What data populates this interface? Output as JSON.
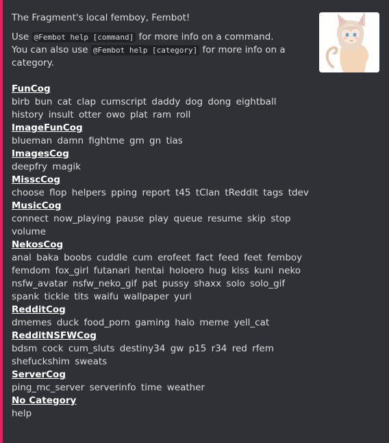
{
  "embed": {
    "accent_color": "#e91e63",
    "intro": "The Fragment's local femboy, Fembot!",
    "usage_line1_prefix": "Use",
    "usage_line1_code": "@Fembot help [command]",
    "usage_line1_suffix": "for more info on a command.",
    "usage_line2_prefix": "You can also use",
    "usage_line2_code": "@Fembot help [category]",
    "usage_line2_suffix": "for more info on a category."
  },
  "categories": [
    {
      "name": "FunCog",
      "commands": [
        "birb",
        "bun",
        "cat",
        "clap",
        "cumscript",
        "daddy",
        "dog",
        "dong",
        "eightball",
        "history",
        "insult",
        "otter",
        "owo",
        "plat",
        "ram",
        "roll"
      ]
    },
    {
      "name": "ImageFunCog",
      "commands": [
        "blueman",
        "damn",
        "fightme",
        "gm",
        "gn",
        "tias"
      ]
    },
    {
      "name": "ImagesCog",
      "commands": [
        "deepfry",
        "magik"
      ]
    },
    {
      "name": "MisscCog",
      "commands": [
        "choose",
        "flop",
        "helpers",
        "pping",
        "report",
        "t45",
        "tClan",
        "tReddit",
        "tags",
        "tdev"
      ]
    },
    {
      "name": "MusicCog",
      "commands": [
        "connect",
        "now_playing",
        "pause",
        "play",
        "queue",
        "resume",
        "skip",
        "stop",
        "volume"
      ]
    },
    {
      "name": "NekosCog",
      "commands": [
        "anal",
        "baka",
        "boobs",
        "cuddle",
        "cum",
        "erofeet",
        "fact",
        "feed",
        "feet",
        "femboy",
        "femdom",
        "fox_girl",
        "futanari",
        "hentai",
        "holoero",
        "hug",
        "kiss",
        "kuni",
        "neko",
        "nsfw_avatar",
        "nsfw_neko_gif",
        "pat",
        "pussy",
        "shaxx",
        "solo",
        "solo_gif",
        "spank",
        "tickle",
        "tits",
        "waifu",
        "wallpaper",
        "yuri"
      ]
    },
    {
      "name": "RedditCog",
      "commands": [
        "dmemes",
        "duck",
        "food_porn",
        "gaming",
        "halo",
        "meme",
        "yell_cat"
      ]
    },
    {
      "name": "RedditNSFWCog",
      "commands": [
        "bdsm",
        "cock",
        "cum_sluts",
        "destiny34",
        "gw",
        "p15",
        "r34",
        "red",
        "rfem",
        "shefuckshim",
        "sweats"
      ]
    },
    {
      "name": "ServerCog",
      "commands": [
        "ping_mc_server",
        "serverinfo",
        "time",
        "weather"
      ]
    },
    {
      "name": "No Category",
      "commands": [
        "help"
      ]
    }
  ]
}
